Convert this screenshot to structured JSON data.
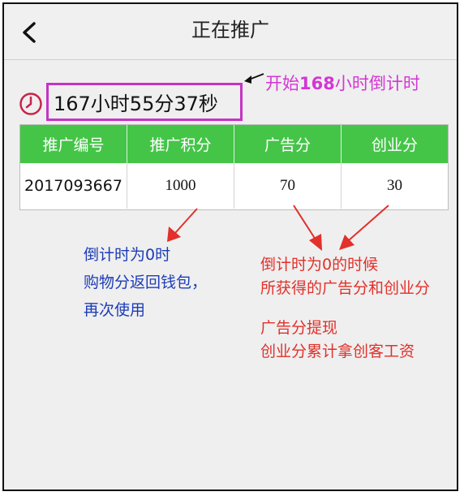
{
  "header": {
    "title": "正在推广"
  },
  "annotation_top": {
    "prefix": "开始",
    "highlight": "168",
    "suffix": "小时倒计时"
  },
  "countdown": "167小时55分37秒",
  "table": {
    "headers": [
      "推广编号",
      "推广积分",
      "广告分",
      "创业分"
    ],
    "row": [
      "2017093667",
      "1000",
      "70",
      "30"
    ]
  },
  "notes": {
    "blue": [
      "倒计时为0时",
      "购物分返回钱包，",
      "再次使用"
    ],
    "red1": [
      "倒计时为0的时候",
      "所获得的广告分和创业分"
    ],
    "red2": [
      "广告分提现",
      "创业分累计拿创客工资"
    ]
  },
  "colors": {
    "header_green": "#45c548",
    "annotation_magenta": "#d436d4",
    "note_blue": "#1c3cb8",
    "note_red": "#e2302a"
  }
}
